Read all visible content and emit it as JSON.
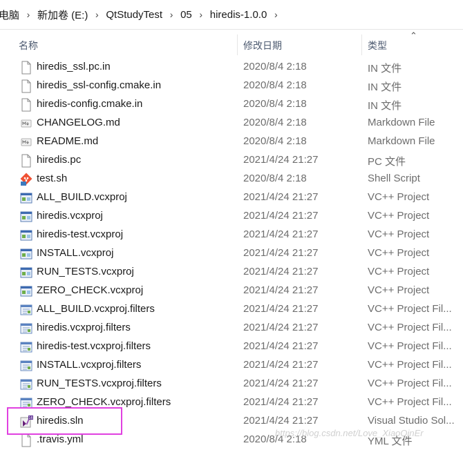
{
  "address_bar": {
    "crumbs": [
      "电脑",
      "新加卷 (E:)",
      "QtStudyTest",
      "05",
      "hiredis-1.0.0"
    ]
  },
  "columns": {
    "name": "名称",
    "date": "修改日期",
    "type": "类型"
  },
  "files": [
    {
      "name": "hiredis_ssl.pc.in",
      "date": "2020/8/4 2:18",
      "type": "IN 文件",
      "icon": "document-icon"
    },
    {
      "name": "hiredis_ssl-config.cmake.in",
      "date": "2020/8/4 2:18",
      "type": "IN 文件",
      "icon": "document-icon"
    },
    {
      "name": "hiredis-config.cmake.in",
      "date": "2020/8/4 2:18",
      "type": "IN 文件",
      "icon": "document-icon"
    },
    {
      "name": "CHANGELOG.md",
      "date": "2020/8/4 2:18",
      "type": "Markdown File",
      "icon": "markdown-icon"
    },
    {
      "name": "README.md",
      "date": "2020/8/4 2:18",
      "type": "Markdown File",
      "icon": "markdown-icon"
    },
    {
      "name": "hiredis.pc",
      "date": "2021/4/24 21:27",
      "type": "PC 文件",
      "icon": "document-icon"
    },
    {
      "name": "test.sh",
      "date": "2020/8/4 2:18",
      "type": "Shell Script",
      "icon": "git-shell-icon"
    },
    {
      "name": "ALL_BUILD.vcxproj",
      "date": "2021/4/24 21:27",
      "type": "VC++ Project",
      "icon": "vcxproj-icon"
    },
    {
      "name": "hiredis.vcxproj",
      "date": "2021/4/24 21:27",
      "type": "VC++ Project",
      "icon": "vcxproj-icon"
    },
    {
      "name": "hiredis-test.vcxproj",
      "date": "2021/4/24 21:27",
      "type": "VC++ Project",
      "icon": "vcxproj-icon"
    },
    {
      "name": "INSTALL.vcxproj",
      "date": "2021/4/24 21:27",
      "type": "VC++ Project",
      "icon": "vcxproj-icon"
    },
    {
      "name": "RUN_TESTS.vcxproj",
      "date": "2021/4/24 21:27",
      "type": "VC++ Project",
      "icon": "vcxproj-icon"
    },
    {
      "name": "ZERO_CHECK.vcxproj",
      "date": "2021/4/24 21:27",
      "type": "VC++ Project",
      "icon": "vcxproj-icon"
    },
    {
      "name": "ALL_BUILD.vcxproj.filters",
      "date": "2021/4/24 21:27",
      "type": "VC++ Project Fil...",
      "icon": "vcxproj-filters-icon"
    },
    {
      "name": "hiredis.vcxproj.filters",
      "date": "2021/4/24 21:27",
      "type": "VC++ Project Fil...",
      "icon": "vcxproj-filters-icon"
    },
    {
      "name": "hiredis-test.vcxproj.filters",
      "date": "2021/4/24 21:27",
      "type": "VC++ Project Fil...",
      "icon": "vcxproj-filters-icon"
    },
    {
      "name": "INSTALL.vcxproj.filters",
      "date": "2021/4/24 21:27",
      "type": "VC++ Project Fil...",
      "icon": "vcxproj-filters-icon"
    },
    {
      "name": "RUN_TESTS.vcxproj.filters",
      "date": "2021/4/24 21:27",
      "type": "VC++ Project Fil...",
      "icon": "vcxproj-filters-icon"
    },
    {
      "name": "ZERO_CHECK.vcxproj.filters",
      "date": "2021/4/24 21:27",
      "type": "VC++ Project Fil...",
      "icon": "vcxproj-filters-icon"
    },
    {
      "name": "hiredis.sln",
      "date": "2021/4/24 21:27",
      "type": "Visual Studio Sol...",
      "icon": "visual-studio-solution-icon"
    },
    {
      "name": ".travis.yml",
      "date": "2020/8/4 2:18",
      "type": "YML 文件",
      "icon": "document-icon"
    }
  ],
  "watermark": "https://blog.csdn.net/Love_XiaoQinEr",
  "colors": {
    "highlight": "#e040e0",
    "muted_text": "#6d6d6d"
  }
}
